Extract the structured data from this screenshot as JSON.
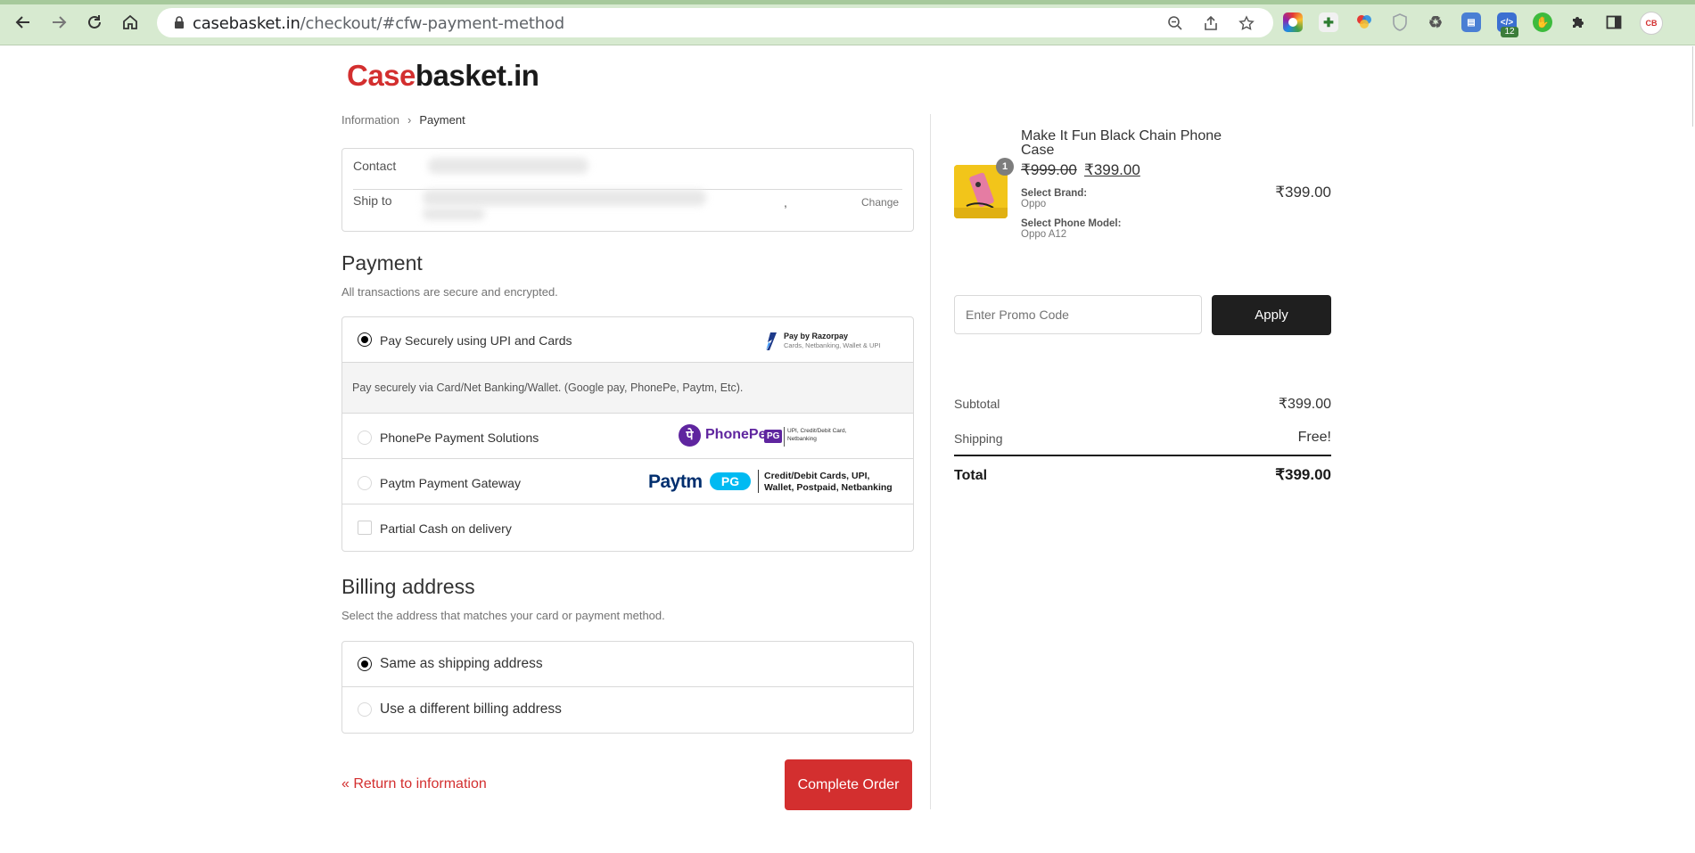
{
  "browser": {
    "url_host": "casebasket.in",
    "url_path": "/checkout/#cfw-payment-method",
    "extension_badge": "12",
    "profile_badge": "CB"
  },
  "logo": {
    "part1": "Case",
    "part2": "basket.in"
  },
  "breadcrumb": {
    "step1": "Information",
    "step2": "Payment"
  },
  "review": {
    "contact_label": "Contact",
    "ship_label": "Ship to",
    "ship_trailing": ",",
    "change_label": "Change"
  },
  "payment": {
    "title": "Payment",
    "subtitle": "All transactions are secure and encrypted.",
    "options": [
      {
        "label": "Pay Securely using UPI and Cards",
        "selected": true
      },
      {
        "label": "PhonePe Payment Solutions",
        "selected": false
      },
      {
        "label": "Paytm Payment Gateway",
        "selected": false
      },
      {
        "label": "Partial Cash on delivery",
        "selected": false
      }
    ],
    "razorpay_desc": "Pay securely via Card/Net Banking/Wallet. (Google pay, PhonePe, Paytm, Etc).",
    "razorpay_logo_title": "Pay by Razorpay",
    "razorpay_logo_sub": "Cards, Netbanking, Wallet & UPI",
    "phonepe_logo_text": "PhonePe",
    "phonepe_pg": "PG",
    "phonepe_logo_sub1": "UPI, Credit/Debit Card,",
    "phonepe_logo_sub2": "Netbanking",
    "paytm_logo_text": "Paytm",
    "paytm_pg": "PG",
    "paytm_logo_sub1": "Credit/Debit Cards, UPI,",
    "paytm_logo_sub2": "Wallet, Postpaid, Netbanking"
  },
  "billing": {
    "title": "Billing address",
    "subtitle": "Select the address that matches your card or payment method.",
    "options": [
      {
        "label": "Same as shipping address",
        "selected": true
      },
      {
        "label": "Use a different billing address",
        "selected": false
      }
    ]
  },
  "actions": {
    "return_label": "« Return to information",
    "complete_label": "Complete Order"
  },
  "cart": {
    "item_name": "Make It Fun Black Chain Phone Case",
    "quantity": "1",
    "price_old": "₹999.00",
    "price_new": "₹399.00",
    "option1_key": "Select Brand:",
    "option1_val": "Oppo",
    "option2_key": "Select Phone Model:",
    "option2_val": "Oppo A12",
    "line_total": "₹399.00"
  },
  "promo": {
    "placeholder": "Enter Promo Code",
    "apply_label": "Apply"
  },
  "summary": {
    "subtotal_label": "Subtotal",
    "subtotal_value": "₹399.00",
    "shipping_label": "Shipping",
    "shipping_value": "Free!",
    "total_label": "Total",
    "total_value": "₹399.00"
  },
  "colors": {
    "brand_red": "#d32f2f",
    "dark": "#1f1f1f",
    "chrome_bg": "#d7ead0"
  }
}
